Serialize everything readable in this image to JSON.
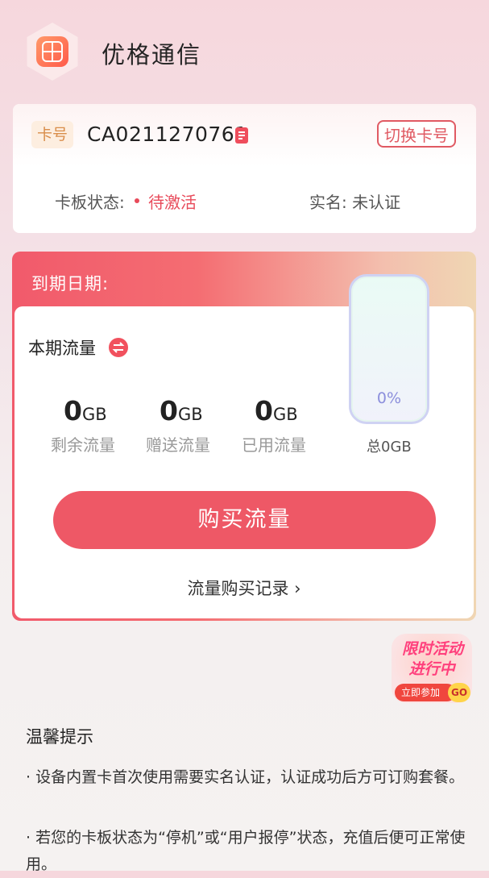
{
  "header": {
    "app_title": "优格通信",
    "logo_icon": "app-logo-icon"
  },
  "card": {
    "badge": "卡号",
    "number": "CA0211270761",
    "switch_label": "切换卡号",
    "status_label": "卡板状态:",
    "status_value": "待激活",
    "status_color": "#e84a5a",
    "realname_text": "实名: 未认证"
  },
  "data_panel": {
    "expiry_label": "到期日期:",
    "period_title": "本期流量",
    "stats": [
      {
        "value": "0",
        "unit": "GB",
        "label": "剩余流量"
      },
      {
        "value": "0",
        "unit": "GB",
        "label": "赠送流量"
      },
      {
        "value": "0",
        "unit": "GB",
        "label": "已用流量"
      }
    ],
    "gauge_percent": "0%",
    "total": "总0GB",
    "buy_label": "购买流量",
    "history_label": "流量购买记录 ›",
    "accent": "#ee5866"
  },
  "promo": {
    "line1": "限时活动",
    "line2": "进行中",
    "cta": "立即参加",
    "go": "GO"
  },
  "tips": {
    "title": "温馨提示",
    "items": [
      "· 设备内置卡首次使用需要实名认证，认证成功后方可订购套餐。",
      "· 若您的卡板状态为“停机”或“用户报停”状态，充值后便可正常使用。"
    ]
  }
}
